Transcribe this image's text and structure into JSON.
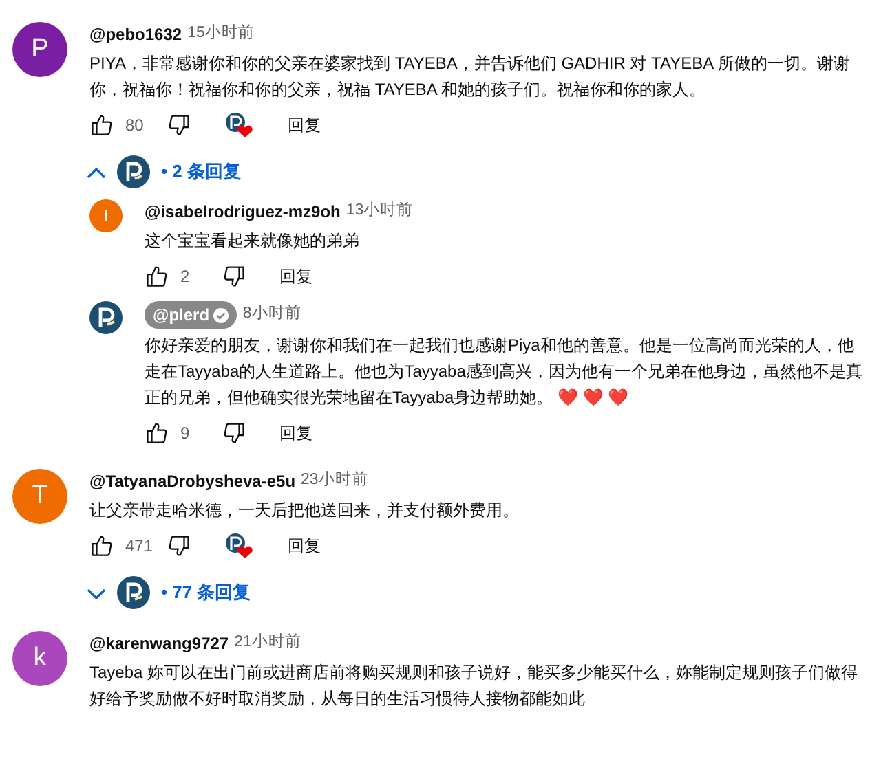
{
  "comments": [
    {
      "avatar_letter": "P",
      "color": "#7b1fa2",
      "author": "@pebo1632",
      "time": "15小时前",
      "text": "PIYA，非常感谢你和你的父亲在婆家找到 TAYEBA，并告诉他们 GADHIR 对 TAYEBA 所做的一切。谢谢你，祝福你！祝福你和你的父亲，祝福 TAYEBA 和她的孩子们。祝福你和你的家人。",
      "likes": "80",
      "hearted": true,
      "reply_label": "回复",
      "replies_toggle": {
        "expanded": true,
        "label": "• 2 条回复"
      },
      "replies": [
        {
          "avatar_letter": "I",
          "color": "#ef6c00",
          "author": "@isabelrodriguez-mz9oh",
          "owner": false,
          "time": "13小时前",
          "text": "这个宝宝看起来就像她的弟弟",
          "likes": "2",
          "reply_label": "回复"
        },
        {
          "color": "#1d4f73",
          "author": "@plerd",
          "owner": true,
          "time": "8小时前",
          "text": "你好亲爱的朋友，谢谢你和我们在一起我们也感谢Piya和他的善意。他是一位高尚而光荣的人，他走在Tayyaba的人生道路上。他也为Tayyaba感到高兴，因为他有一个兄弟在他身边，虽然他不是真正的兄弟，但他确实很光荣地留在Tayyaba身边帮助她。 ❤️ ❤️ ❤️",
          "likes": "9",
          "reply_label": "回复"
        }
      ]
    },
    {
      "avatar_letter": "T",
      "color": "#ef6c00",
      "author": "@TatyanaDrobysheva-e5u",
      "time": "23小时前",
      "text": "让父亲带走哈米德，一天后把他送回来，并支付额外费用。",
      "likes": "471",
      "hearted": true,
      "reply_label": "回复",
      "replies_toggle": {
        "expanded": false,
        "label": "• 77 条回复"
      }
    },
    {
      "avatar_letter": "k",
      "color": "#ab47bc",
      "author": "@karenwang9727",
      "time": "21小时前",
      "text": "Tayeba 妳可以在出门前或进商店前将购买规则和孩子说好，能买多少能买什么，妳能制定规则孩子们做得好给予奖励做不好时取消奖励，从每日的生活习惯待人接物都能如此"
    }
  ]
}
